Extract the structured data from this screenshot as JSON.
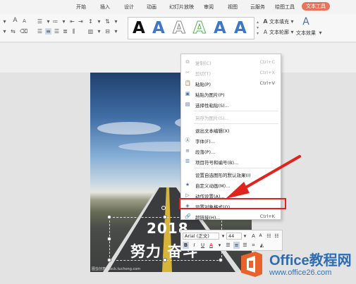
{
  "ribbon_tabs": [
    "开始",
    "插入",
    "设计",
    "动画",
    "幻灯片放映",
    "审阅",
    "视图",
    "云服务",
    "绘图工具",
    "文本工具"
  ],
  "active_tab": "文本工具",
  "ribbon": {
    "wordart_letter": "A",
    "text_fill_label": "文本填充",
    "text_outline_label": "文本轮廓",
    "text_effect_label": "文本效果",
    "text_effect_icon": "A",
    "font_size_up": "A",
    "font_size_down": "A"
  },
  "wordart_styles": [
    {
      "color": "#111111",
      "style": "solid"
    },
    {
      "color": "#3d78c8",
      "style": "solid"
    },
    {
      "color": "#888888",
      "style": "outline"
    },
    {
      "color": "#55b055",
      "style": "outline"
    },
    {
      "color": "#3d78c8",
      "style": "solid"
    },
    {
      "color": "#3d78c8",
      "style": "solid"
    }
  ],
  "slide": {
    "line1": "2018",
    "line2": "努力 奋斗",
    "credit": "图虫创意 stock.tuchong.com"
  },
  "context_menu": [
    {
      "label": "复制(C)",
      "key": "Ctrl+C",
      "icon": "copy-icon",
      "glyph": "⧉",
      "disabled": true
    },
    {
      "label": "剪切(T)",
      "key": "Ctrl+X",
      "icon": "cut-icon",
      "glyph": "✂",
      "disabled": true
    },
    {
      "label": "粘贴(P)",
      "key": "Ctrl+V",
      "icon": "paste-icon",
      "glyph": "📋",
      "disabled": false
    },
    {
      "label": "粘贴为图片(P)",
      "key": "",
      "icon": "paste-picture-icon",
      "glyph": "▣",
      "disabled": false
    },
    {
      "label": "选择性粘贴(S)...",
      "key": "",
      "icon": "paste-special-icon",
      "glyph": "▤",
      "disabled": false
    },
    {
      "separator": true
    },
    {
      "label": "另存为图片(S)...",
      "key": "",
      "icon": "",
      "glyph": "",
      "disabled": true
    },
    {
      "separator": true
    },
    {
      "label": "退出文本编辑(X)",
      "key": "",
      "icon": "",
      "glyph": "",
      "disabled": false
    },
    {
      "label": "字体(F)...",
      "key": "",
      "icon": "font-icon",
      "glyph": "Ⓐ",
      "disabled": false
    },
    {
      "label": "段落(P)...",
      "key": "",
      "icon": "paragraph-icon",
      "glyph": "≡",
      "disabled": false
    },
    {
      "label": "项目符号和编号(B)...",
      "key": "",
      "icon": "bullets-icon",
      "glyph": "☰",
      "disabled": false
    },
    {
      "separator": true
    },
    {
      "label": "设置自选图形的默认效果(I)",
      "key": "",
      "icon": "",
      "glyph": "",
      "disabled": false
    },
    {
      "label": "自定义动画(M)...",
      "key": "",
      "icon": "custom-animation-icon",
      "glyph": "★",
      "disabled": false
    },
    {
      "label": "动作设置(A)...",
      "key": "",
      "icon": "action-settings-icon",
      "glyph": "▷",
      "disabled": false
    },
    {
      "label": "设置对象格式(O)...",
      "key": "",
      "icon": "format-object-icon",
      "glyph": "◈",
      "disabled": false
    },
    {
      "label": "超链接(H)...",
      "key": "Ctrl+K",
      "icon": "hyperlink-icon",
      "glyph": "🔗",
      "disabled": false
    }
  ],
  "mini_toolbar": {
    "font_name": "Arial (正文)",
    "font_size": "44",
    "bold": "B",
    "italic": "I",
    "underline": "U",
    "font_color": "A"
  },
  "watermark": {
    "line1": "Office教程网",
    "line2": "www.office26.com"
  }
}
